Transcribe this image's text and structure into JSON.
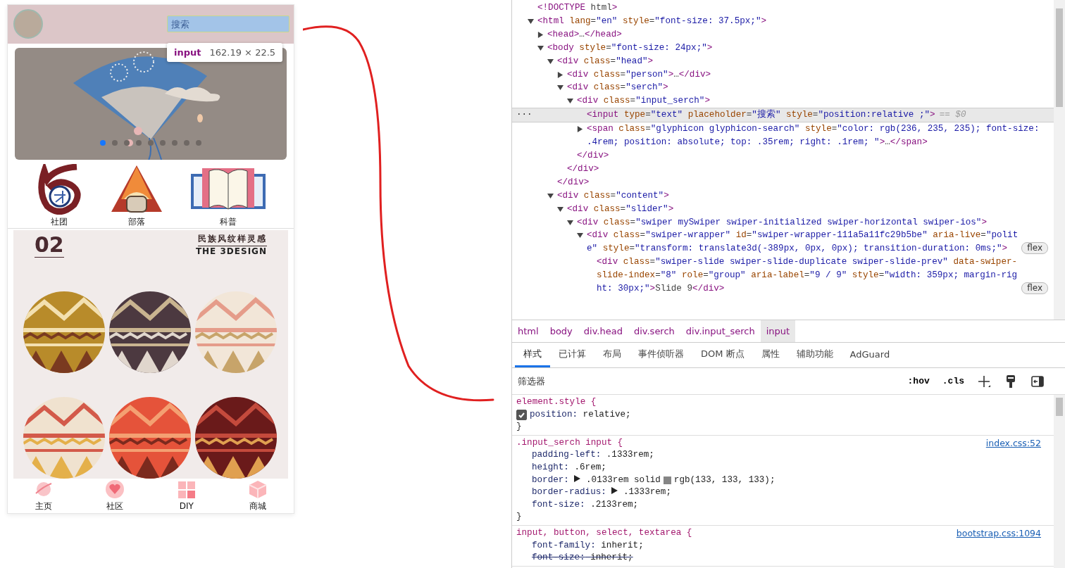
{
  "phone": {
    "search": {
      "placeholder": "搜索"
    },
    "inspect_tooltip": {
      "tag": "input",
      "size": "162.19 × 22.5"
    },
    "banner": {
      "dots": [
        {
          "selected": true
        },
        {
          "selected": false
        },
        {
          "selected": false
        },
        {
          "selected": false
        },
        {
          "selected": false
        },
        {
          "selected": false
        },
        {
          "selected": false
        },
        {
          "selected": false
        },
        {
          "selected": false
        }
      ]
    },
    "categories": [
      {
        "label": "社团"
      },
      {
        "label": "部落"
      },
      {
        "label": "科普"
      }
    ],
    "poster": {
      "number": "02",
      "title": "民族风纹样灵感",
      "subtitle": "THE 3DESIGN"
    },
    "tab_bar": [
      {
        "label": "主页"
      },
      {
        "label": "社区"
      },
      {
        "label": "DIY"
      },
      {
        "label": "商城"
      }
    ]
  },
  "devtools": {
    "dom_tree": [
      {
        "text": "<!DOCTYPE html>"
      },
      {
        "text": "<html lang=\"en\" style=\"font-size: 37.5px;\">",
        "expanded": true,
        "children": [
          {
            "text": "<head>…</head>",
            "expanded": false
          },
          {
            "text": "<body style=\"font-size: 24px;\">",
            "expanded": true,
            "children": [
              {
                "text": "<div class=\"head\">",
                "expanded": true,
                "close": "</div>",
                "children": [
                  {
                    "text": "<div class=\"person\">…</div>",
                    "expanded": false
                  },
                  {
                    "text": "<div class=\"serch\">",
                    "expanded": true,
                    "close": "</div>",
                    "children": [
                      {
                        "text": "<div class=\"input_serch\">",
                        "expanded": true,
                        "close": "</div>",
                        "children": [
                          {
                            "text": "<input type=\"text\" placeholder=\"搜索\" style=\"position:relative ;\">",
                            "selected": true,
                            "gutter": "···",
                            "suffix": "== $0"
                          },
                          {
                            "text": "<span class=\"glyphicon glyphicon-search\" style=\"color: rgb(236, 235, 235); font-size: .4rem; position: absolute; top: .35rem; right: .1rem; \">…</span>",
                            "expanded": false,
                            "selected": false
                          }
                        ]
                      }
                    ]
                  }
                ]
              },
              {
                "text": "<div class=\"content\">",
                "expanded": true,
                "children": [
                  {
                    "text": "<div class=\"slider\">",
                    "expanded": true,
                    "children": [
                      {
                        "text": "<div class=\"swiper mySwiper swiper-initialized swiper-horizontal swiper-ios\">",
                        "expanded": true,
                        "children": [
                          {
                            "text": "<div class=\"swiper-wrapper\" id=\"swiper-wrapper-111a5a11fc29b5be\" aria-live=\"polite\" style=\"transform: translate3d(-389px, 0px, 0px); transition-duration: 0ms;\">",
                            "expanded": true,
                            "badge": "flex",
                            "children": [
                              {
                                "text": "<div class=\"swiper-slide swiper-slide-duplicate swiper-slide-prev\" data-swiper-slide-index=\"8\" role=\"group\" aria-label=\"9 / 9\" style=\"width: 359px; margin-right: 30px;\">Slide 9</div>",
                                "badge": "flex"
                              }
                            ]
                          }
                        ]
                      }
                    ]
                  }
                ]
              }
            ]
          }
        ]
      }
    ],
    "breadcrumbs": [
      {
        "label": "html",
        "selected": false
      },
      {
        "label": "body",
        "selected": false
      },
      {
        "label": "div.head",
        "selected": false
      },
      {
        "label": "div.serch",
        "selected": false
      },
      {
        "label": "div.input_serch",
        "selected": false
      },
      {
        "label": "input",
        "selected": true
      }
    ],
    "tabs": [
      {
        "label": "样式",
        "selected": true
      },
      {
        "label": "已计算",
        "selected": false
      },
      {
        "label": "布局",
        "selected": false
      },
      {
        "label": "事件侦听器",
        "selected": false
      },
      {
        "label": "DOM 断点",
        "selected": false
      },
      {
        "label": "属性",
        "selected": false
      },
      {
        "label": "辅助功能",
        "selected": false
      },
      {
        "label": "AdGuard",
        "selected": false
      }
    ],
    "filter": {
      "placeholder": "筛选器"
    },
    "toolbar": [
      {
        "kind": "text",
        "label": ":hov"
      },
      {
        "kind": "text",
        "label": ".cls"
      },
      {
        "kind": "plus"
      },
      {
        "kind": "paint"
      },
      {
        "kind": "sidebar"
      }
    ],
    "rules": [
      {
        "selector": "element.style {",
        "props": [
          {
            "name": "position:",
            "value": "relative;",
            "checked": true
          }
        ],
        "close": "}"
      },
      {
        "selector": ".input_serch input {",
        "source": "index.css:52",
        "props": [
          {
            "name": "padding-left:",
            "value": ".1333rem;"
          },
          {
            "name": "height:",
            "value": ".6rem;"
          },
          {
            "name": "border:",
            "value": ".0133rem solid",
            "expandable": true,
            "color": "#858585",
            "color_text": "rgb(133, 133, 133);"
          },
          {
            "name": "border-radius:",
            "value": ".1333rem;",
            "expandable": true
          },
          {
            "name": "font-size:",
            "value": ".2133rem;"
          }
        ],
        "close": "}"
      },
      {
        "selector": "input, button, select, textarea {",
        "source": "bootstrap.css:1094",
        "props": [
          {
            "name": "font-family:",
            "value": "inherit;",
            "overridden": false
          },
          {
            "name": "font-size:",
            "value": "inherit;",
            "overridden": true
          }
        ]
      }
    ]
  }
}
